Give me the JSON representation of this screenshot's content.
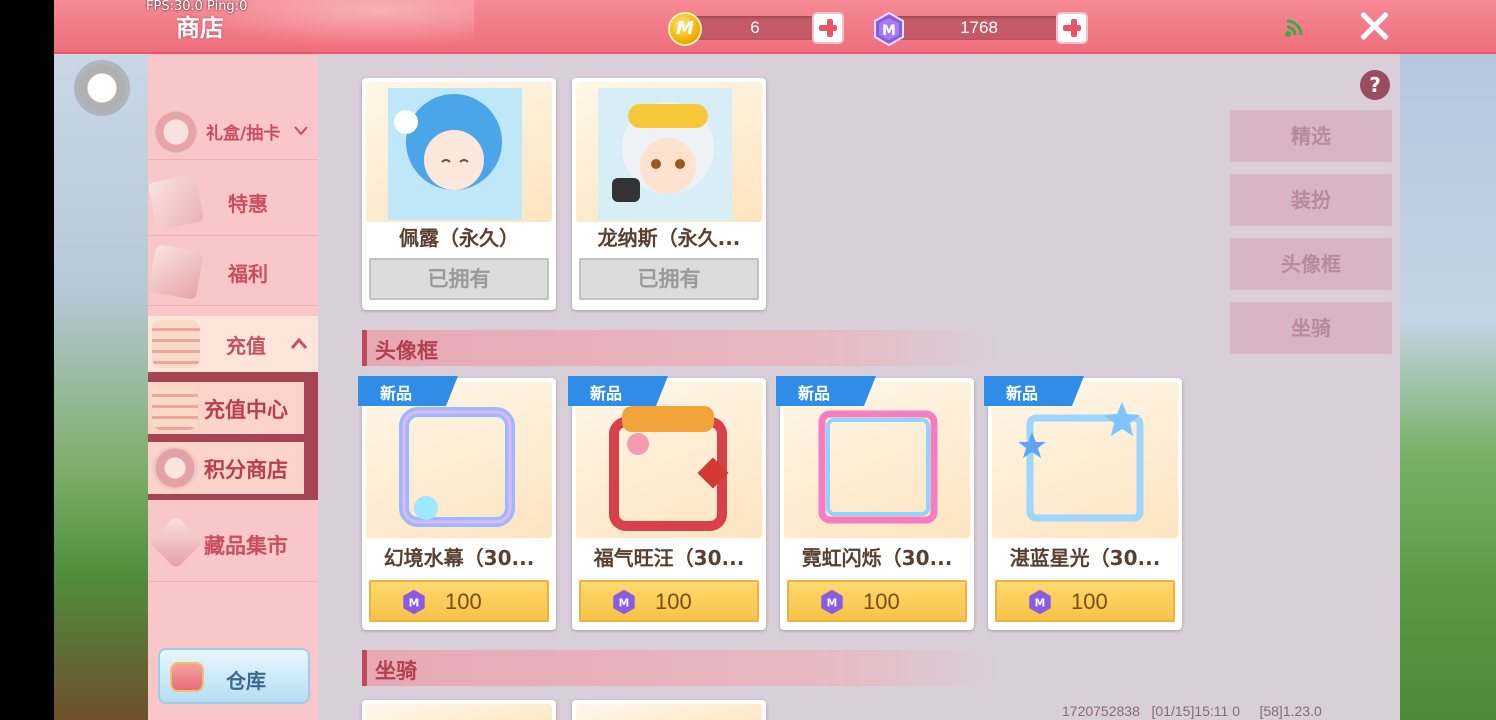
{
  "debug": {
    "fps": "FPS:30.0  Ping:0"
  },
  "header": {
    "title": "商店"
  },
  "currency": {
    "coin": {
      "icon": "m-coin-icon",
      "value": "6"
    },
    "gem": {
      "icon": "m-gem-icon",
      "value": "1768"
    }
  },
  "sidebar": {
    "items": [
      {
        "label": "礼盒/抽卡",
        "icon": "gift-box-icon"
      },
      {
        "label": "特惠",
        "icon": "discount-box-icon"
      },
      {
        "label": "福利",
        "icon": "welfare-gift-icon"
      },
      {
        "label": "充值",
        "icon": "coin-stack-icon"
      },
      {
        "label": "藏品集市",
        "icon": "gem-collection-icon"
      }
    ],
    "sub_items": [
      {
        "label": "充值中心",
        "icon": "coin-stack-icon"
      },
      {
        "label": "积分商店",
        "icon": "m-coin-icon"
      }
    ],
    "warehouse": {
      "label": "仓库",
      "icon": "warehouse-chest-icon"
    }
  },
  "right_tabs": [
    "精选",
    "装扮",
    "头像框",
    "坐骑"
  ],
  "skins": [
    {
      "name": "佩露（永久）",
      "status": "已拥有"
    },
    {
      "name": "龙纳斯（永久...",
      "status": "已拥有"
    }
  ],
  "sections": {
    "frames": "头像框",
    "mounts": "坐骑"
  },
  "frames": [
    {
      "badge": "新品",
      "name": "幻境水幕（30...",
      "price": "100"
    },
    {
      "badge": "新品",
      "name": "福气旺汪（30...",
      "price": "100"
    },
    {
      "badge": "新品",
      "name": "霓虹闪烁（30...",
      "price": "100"
    },
    {
      "badge": "新品",
      "name": "湛蓝星光（30...",
      "price": "100"
    }
  ],
  "footer": {
    "info": "1720752838   [01/15]15:11 0     [58]1.23.0"
  },
  "colors": {
    "topbar": "#ef6e7c",
    "sidebar": "#f9c6c9",
    "accent": "#c8505e",
    "panel": "#d8cfd8"
  }
}
